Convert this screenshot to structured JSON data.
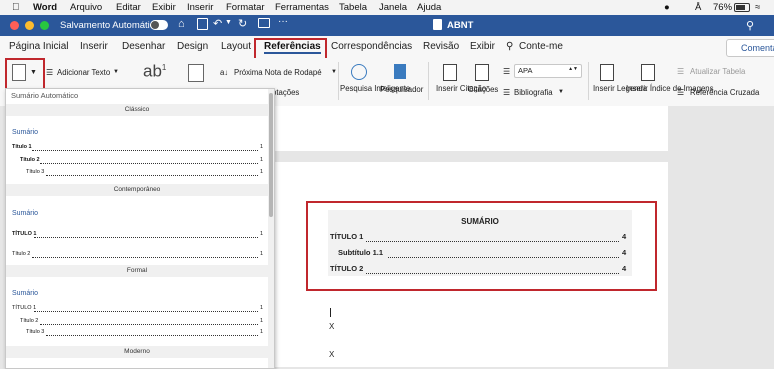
{
  "menubar": {
    "app": "Word",
    "items": [
      "Arquivo",
      "Editar",
      "Exibir",
      "Inserir",
      "Formatar",
      "Ferramentas",
      "Tabela",
      "Janela",
      "Ajuda"
    ],
    "battery": "76%"
  },
  "titlebar": {
    "autosave_label": "Salvamento Automático",
    "doc_title": "ABNT"
  },
  "tabs": {
    "items": [
      "Página Inicial",
      "Inserir",
      "Desenhar",
      "Design",
      "Layout",
      "Referências",
      "Correspondências",
      "Revisão",
      "Exibir"
    ],
    "active": "Referências",
    "tell_me": "Conte-me",
    "comments": "Comentá"
  },
  "ribbon": {
    "add_text": "Adicionar Texto",
    "next_footnote": "Próxima Nota de Rodapé",
    "notes_partial": "otações",
    "smart_search": "Pesquisa Inteligente",
    "researcher": "Pesquisador",
    "insert_citation": "Inserir Citação",
    "citations": "Citações",
    "style_value": "APA",
    "bibliography": "Bibliografia",
    "insert_caption": "Inserir Legenda",
    "insert_figures_index": "Inserir Índice de Imagens",
    "update_table": "Atualizar Tabela",
    "cross_reference": "Referência Cruzada"
  },
  "dropdown": {
    "header": "Sumário Automático",
    "sections": [
      {
        "name": "Clássico",
        "title": "Sumário",
        "lines": [
          "Título 1",
          "Título 2",
          "Título 3"
        ],
        "pages": [
          "1",
          "1",
          "1"
        ]
      },
      {
        "name": "Contemporâneo",
        "title": "Sumário",
        "lines": [
          "TÍTULO 1",
          "Título 2"
        ],
        "pages": [
          "1",
          "1"
        ]
      },
      {
        "name": "Formal",
        "title": "Sumário",
        "lines": [
          "TÍTULO 1",
          "Título 2",
          "Título 3"
        ],
        "pages": [
          "1",
          "1",
          "1"
        ]
      },
      {
        "name": "Moderno"
      }
    ]
  },
  "document": {
    "toc_title": "SUMÁRIO",
    "entries": [
      {
        "text": "TÍTULO 1",
        "page": "4"
      },
      {
        "text": "Subtítulo 1.1",
        "page": "4"
      },
      {
        "text": "TÍTULO 2",
        "page": "4"
      }
    ],
    "body_lines": [
      "X",
      "X"
    ]
  },
  "colors": {
    "title_blue": "#2b579a",
    "highlight_red": "#c0272d"
  }
}
